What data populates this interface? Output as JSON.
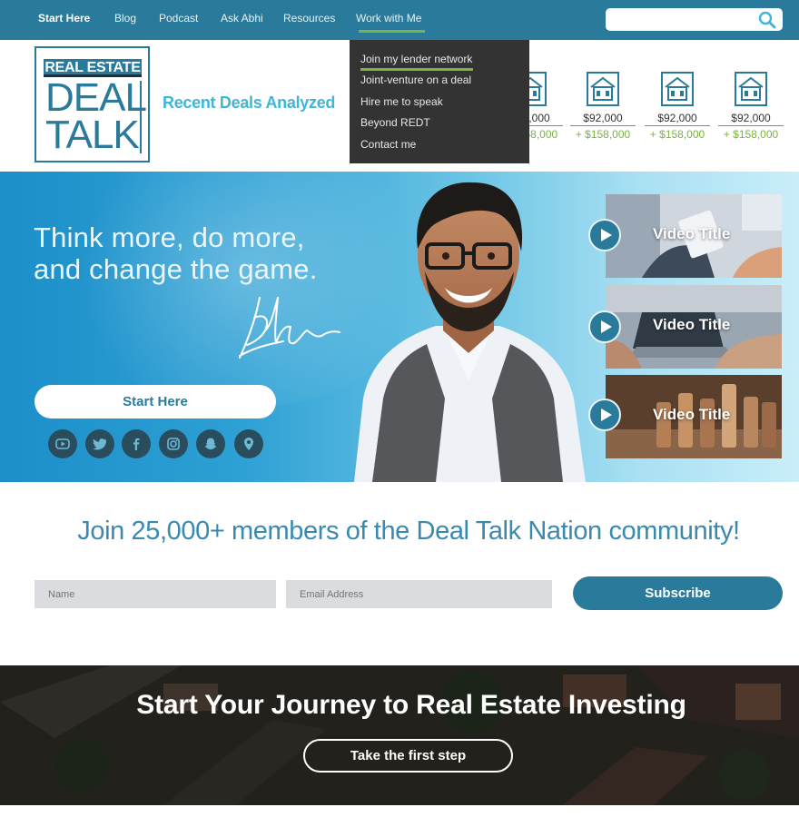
{
  "nav": {
    "items": [
      {
        "label": "Start Here"
      },
      {
        "label": "Blog"
      },
      {
        "label": "Podcast"
      },
      {
        "label": "Ask Abhi"
      },
      {
        "label": "Resources"
      },
      {
        "label": "Work with Me"
      }
    ],
    "active": "Start Here",
    "open_menu": "Work with Me",
    "search_placeholder": ""
  },
  "dropdown": {
    "items": [
      {
        "label": "Join my lender network"
      },
      {
        "label": "Joint-venture on a deal"
      },
      {
        "label": "Hire me to speak"
      },
      {
        "label": "Beyond REDT"
      },
      {
        "label": "Contact me"
      }
    ],
    "highlighted": "Join my lender network"
  },
  "logo": {
    "tag": "REAL ESTATE",
    "line1": "DEAL",
    "line2": "TALK"
  },
  "recent_deals": {
    "title": "Recent Deals Analyzed",
    "deals": [
      {
        "price": "$92,000",
        "profit": "+ $158,000"
      },
      {
        "price": "$92,000",
        "profit": "+ $158,000"
      },
      {
        "price": "$92,000",
        "profit": "+ $158,000"
      },
      {
        "price": "$92,000",
        "profit": "+ $158,000"
      }
    ]
  },
  "hero": {
    "tagline_line1": "Think more, do more,",
    "tagline_line2": "and change the game.",
    "cta": "Start Here",
    "social_icons": [
      "youtube-icon",
      "twitter-icon",
      "facebook-icon",
      "instagram-icon",
      "snapchat-icon",
      "location-icon"
    ]
  },
  "videos": [
    {
      "title": "Video Title"
    },
    {
      "title": "Video Title"
    },
    {
      "title": "Video Title"
    }
  ],
  "join": {
    "title": "Join 25,000+ members of the Deal Talk Nation community!",
    "name_placeholder": "Name",
    "email_placeholder": "Email Address",
    "subscribe": "Subscribe"
  },
  "journey": {
    "title": "Start Your Journey to Real Estate Investing",
    "cta": "Take the first step"
  },
  "colors": {
    "brand": "#2a7b9b",
    "accent_green": "#7cb342",
    "heading_blue": "#3fb6d6",
    "dropdown_bg": "#333333"
  }
}
